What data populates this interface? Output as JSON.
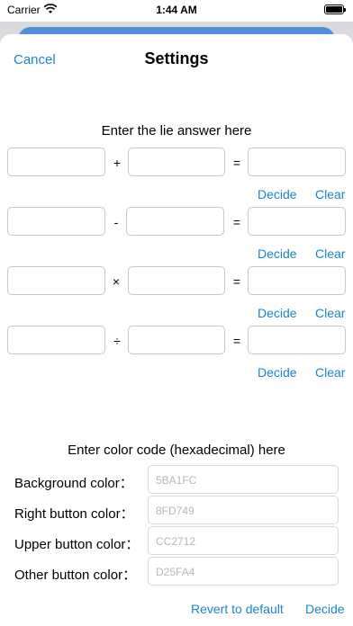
{
  "status_bar": {
    "carrier": "Carrier",
    "time": "1:44 AM"
  },
  "nav": {
    "cancel": "Cancel",
    "title": "Settings"
  },
  "lie_section": {
    "title": "Enter the lie answer here",
    "rows": [
      {
        "operator": "+",
        "equals": "=",
        "decide": "Decide",
        "clear": "Clear"
      },
      {
        "operator": "-",
        "equals": "=",
        "decide": "Decide",
        "clear": "Clear"
      },
      {
        "operator": "×",
        "equals": "=",
        "decide": "Decide",
        "clear": "Clear"
      },
      {
        "operator": "÷",
        "equals": "=",
        "decide": "Decide",
        "clear": "Clear"
      }
    ]
  },
  "color_section": {
    "title": "Enter color code (hexadecimal) here",
    "fields": [
      {
        "label": "Background color：",
        "placeholder": "5BA1FC"
      },
      {
        "label": "Right button color：",
        "placeholder": "8FD749"
      },
      {
        "label": "Upper button color：",
        "placeholder": "CC2712"
      },
      {
        "label": "Other button color：",
        "placeholder": "D25FA4"
      }
    ],
    "revert": "Revert to default",
    "decide": "Decide"
  },
  "colors": {
    "accent": "#1a86c7",
    "field_border": "#c7c7cc",
    "placeholder": "#b6b6bc"
  }
}
